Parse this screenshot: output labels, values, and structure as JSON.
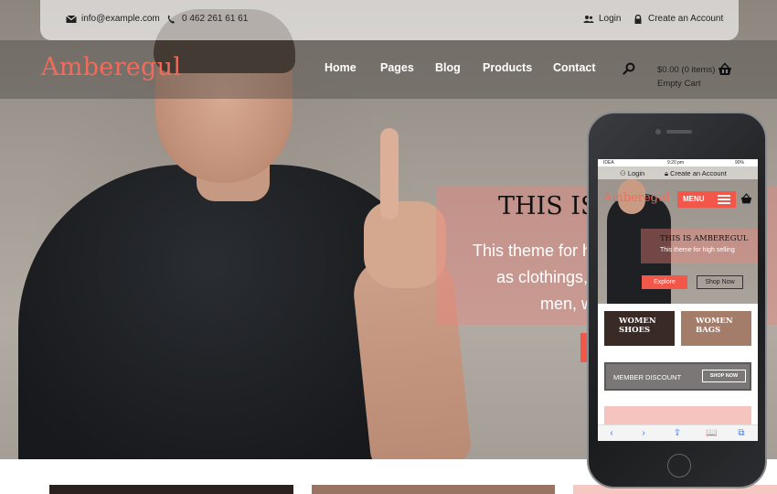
{
  "topbar": {
    "email": "info@example.com",
    "phone": "0 462 261 61 61",
    "login": "Login",
    "create_account": "Create an Account"
  },
  "nav": {
    "logo": "Amberegul",
    "links": [
      "Home",
      "Pages",
      "Blog",
      "Products",
      "Contact"
    ],
    "cart_total": "$0.00 (0 items)",
    "cart_status": "Empty Cart"
  },
  "hero": {
    "title": "THIS IS",
    "line1": "This theme for h",
    "line2": "as clothings,",
    "line3": "men, w"
  },
  "phone": {
    "status_carrier": "IDEA",
    "status_time": "9:20 pm",
    "status_battery": "90%",
    "login": "Login",
    "create_account": "Create an Account",
    "logo": "Amberegul",
    "menu_label": "MENU",
    "caption_title": "THIS IS AMBEREGUL",
    "caption_sub": "This theme for high selling",
    "explore": "Explore",
    "shop_now": "Shop Now",
    "tile_shoes_1": "WOMEN",
    "tile_shoes_2": "SHOES",
    "tile_bags_1": "WOMEN",
    "tile_bags_2": "BAGS",
    "discount": "MEMBER DISCOUNT",
    "discount_btn": "SHOP NOW",
    "browser_icons": [
      "‹",
      "›",
      "⇪",
      "📖",
      "⧉"
    ]
  },
  "colors": {
    "accent": "#f26b5b",
    "button": "#f2574a",
    "tile_dark": "#3a2a26",
    "tile_brown": "#a37c6a"
  }
}
